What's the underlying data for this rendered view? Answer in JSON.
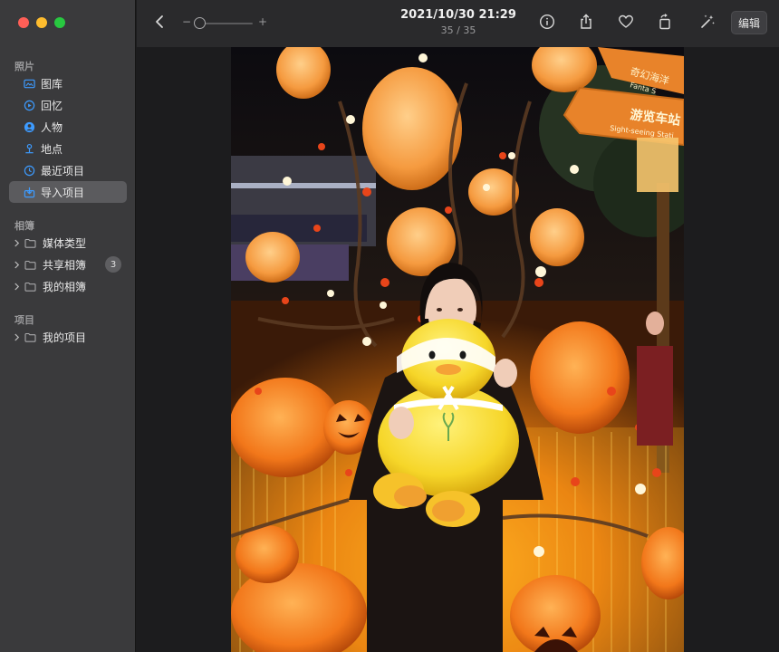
{
  "sidebar": {
    "sections": {
      "photos": "照片",
      "albums": "相簿",
      "projects": "项目"
    },
    "items": [
      {
        "label": "图库",
        "icon": "library-icon"
      },
      {
        "label": "回忆",
        "icon": "memories-icon"
      },
      {
        "label": "人物",
        "icon": "people-icon"
      },
      {
        "label": "地点",
        "icon": "places-icon"
      },
      {
        "label": "最近项目",
        "icon": "recent-icon"
      },
      {
        "label": "导入项目",
        "icon": "import-icon",
        "selected": true
      }
    ],
    "albums": [
      {
        "label": "媒体类型"
      },
      {
        "label": "共享相簿",
        "badge": "3"
      },
      {
        "label": "我的相簿"
      }
    ],
    "projects": [
      {
        "label": "我的项目"
      }
    ]
  },
  "toolbar": {
    "zoom_minus": "−",
    "zoom_plus": "+",
    "zoom_level": 0.0,
    "date": "2021/10/30 21:29",
    "count": "35 / 35",
    "edit_label": "编辑"
  },
  "photo": {
    "sign_text": "游览车站",
    "sign_subtext": "Sight-seeing Stati",
    "sign_top_text": "奇幻海洋",
    "sign_top_sub": "Fanta S"
  },
  "colors": {
    "accent": "#3d9bff",
    "sidebar_bg": "#3a3a3c",
    "toolbar_bg": "#2a2a2c"
  }
}
